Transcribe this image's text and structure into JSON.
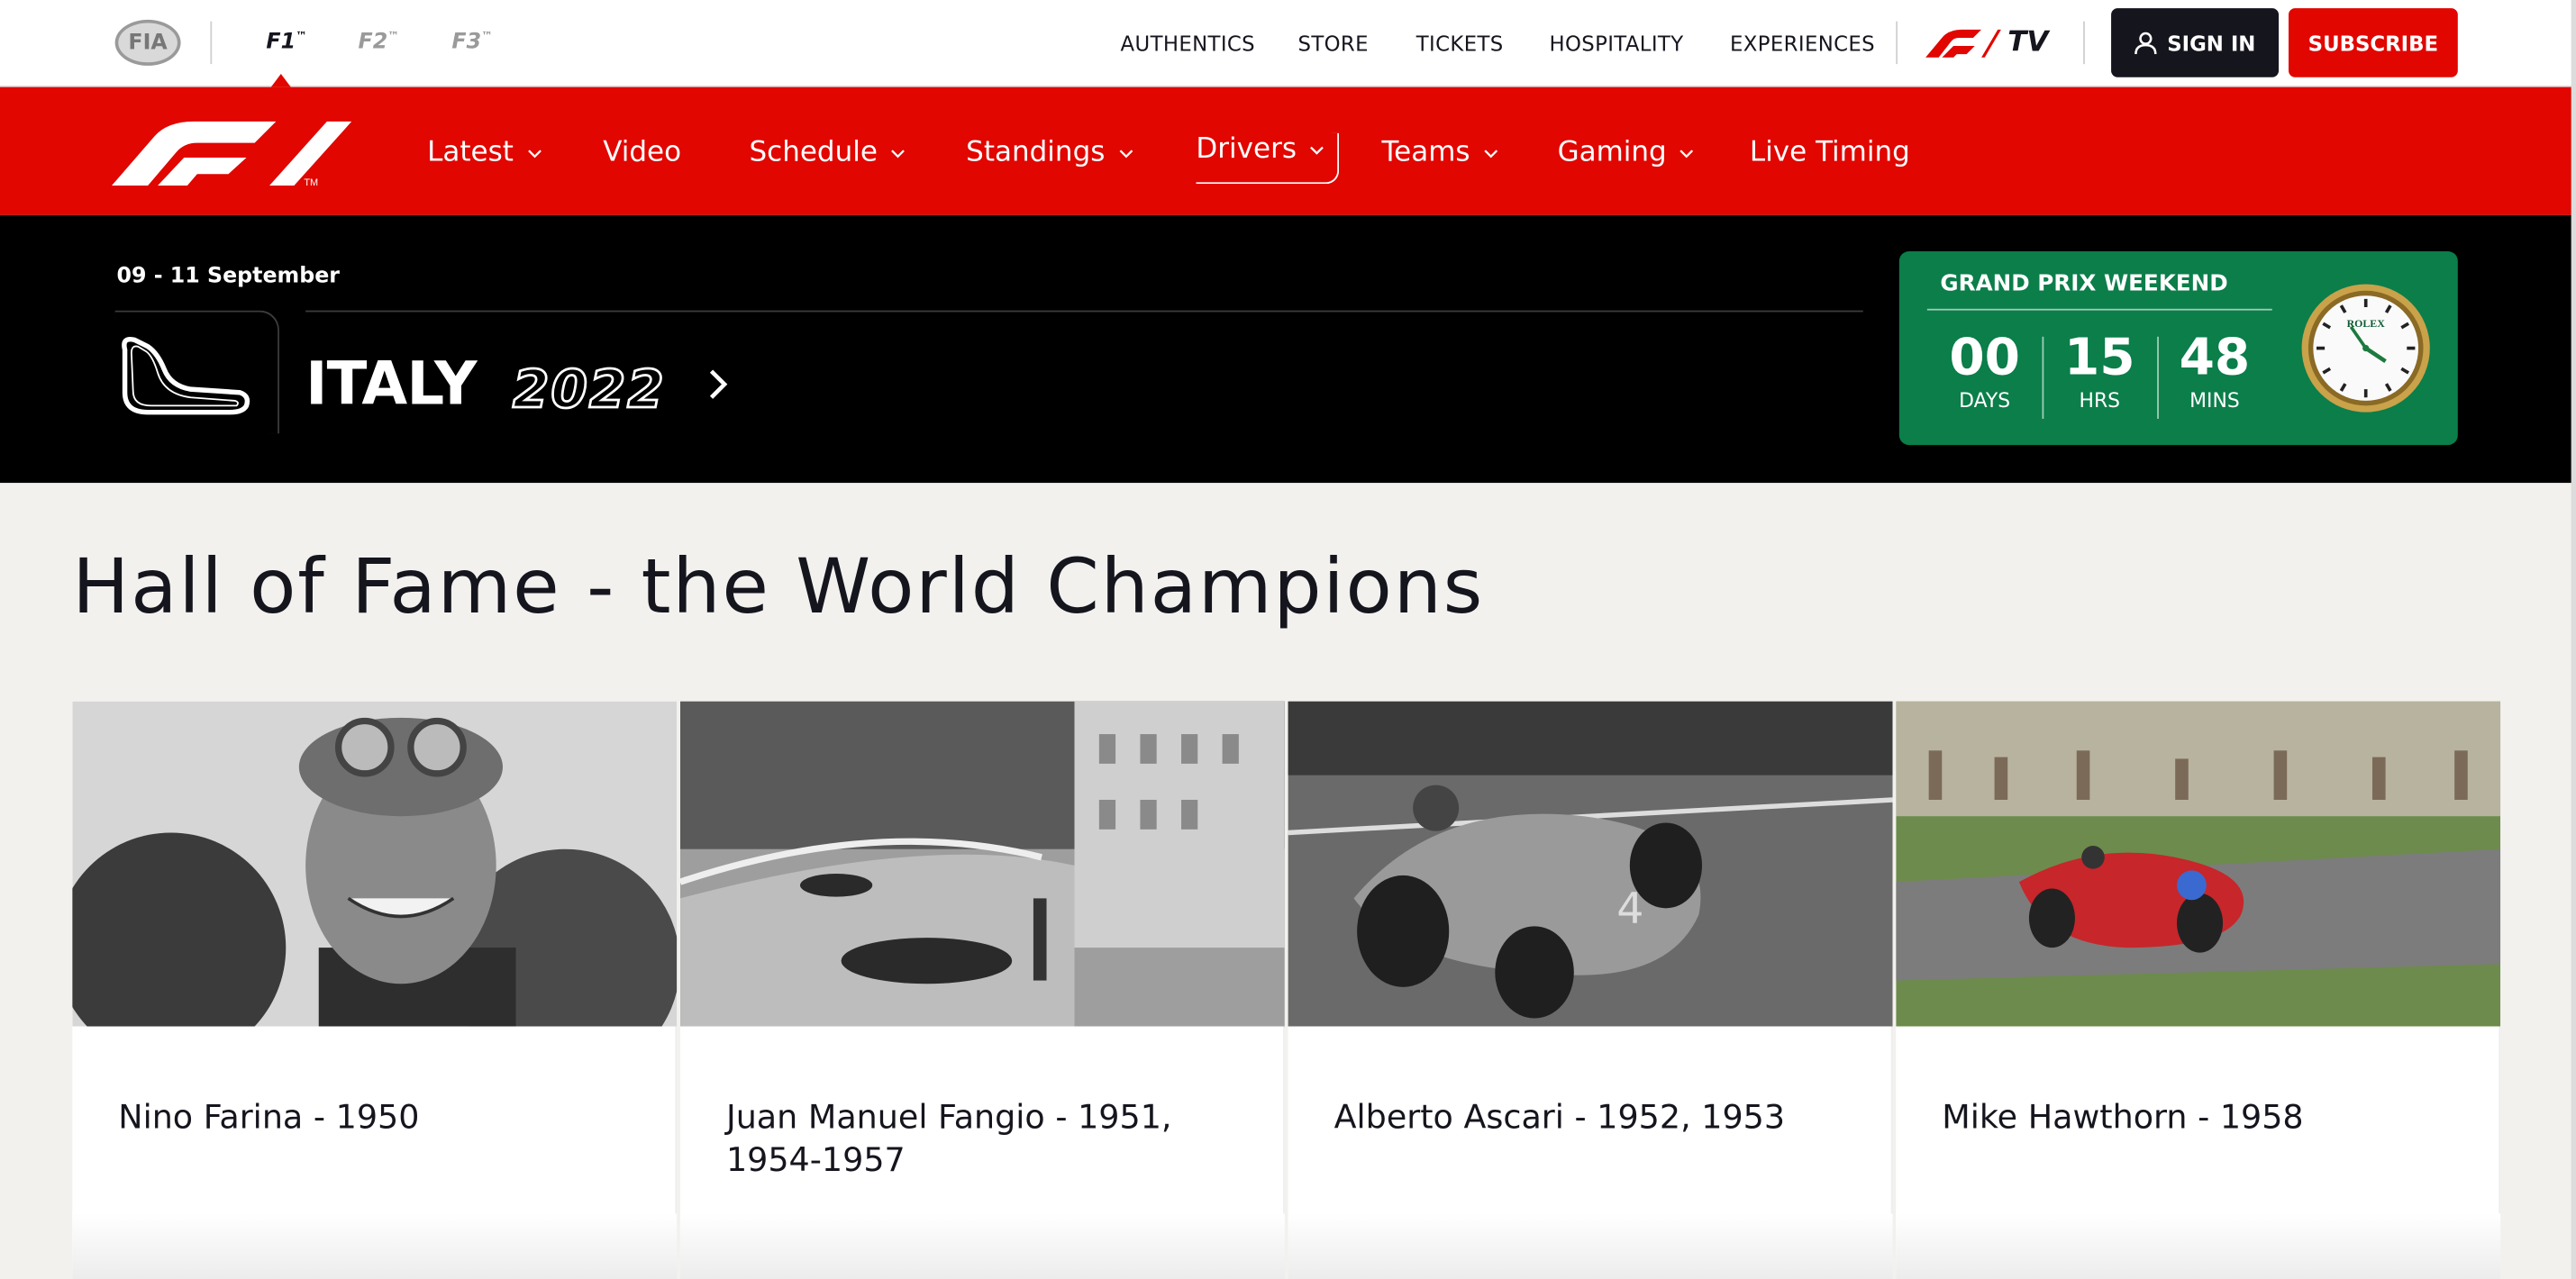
{
  "topbar": {
    "fia_label": "FIA",
    "series": [
      {
        "label": "F1",
        "tm": "™"
      },
      {
        "label": "F2",
        "tm": "™"
      },
      {
        "label": "F3",
        "tm": "™"
      }
    ],
    "links": [
      "AUTHENTICS",
      "STORE",
      "TICKETS",
      "HOSPITALITY",
      "EXPERIENCES"
    ],
    "f1tv_label": "TV",
    "signin_label": "SIGN IN",
    "subscribe_label": "SUBSCRIBE"
  },
  "nav": {
    "items": [
      {
        "label": "Latest",
        "dropdown": true
      },
      {
        "label": "Video",
        "dropdown": false
      },
      {
        "label": "Schedule",
        "dropdown": true
      },
      {
        "label": "Standings",
        "dropdown": true
      },
      {
        "label": "Drivers",
        "dropdown": true,
        "active": true
      },
      {
        "label": "Teams",
        "dropdown": true
      },
      {
        "label": "Gaming",
        "dropdown": true
      },
      {
        "label": "Live Timing",
        "dropdown": false
      }
    ]
  },
  "race": {
    "dates": "09 - 11 September",
    "country": "ITALY",
    "year": "2022",
    "gpw_title": "GRAND PRIX WEEKEND",
    "countdown": [
      {
        "value": "00",
        "unit": "DAYS"
      },
      {
        "value": "15",
        "unit": "HRS"
      },
      {
        "value": "48",
        "unit": "MINS"
      }
    ],
    "clock_brand": "ROLEX",
    "accent_color": "#0b7e4a"
  },
  "page": {
    "title": "Hall of Fame - the World Champions"
  },
  "champions": [
    {
      "name": "Nino Farina - 1950",
      "photo": "bw-portrait"
    },
    {
      "name": "Juan Manuel Fangio - 1951, 1954-1957",
      "photo": "bw-street-circuit"
    },
    {
      "name": "Alberto Ascari - 1952, 1953",
      "photo": "bw-race-car"
    },
    {
      "name": "Mike Hawthorn - 1958",
      "photo": "color-race-car"
    }
  ],
  "colors": {
    "brand_red": "#e10600",
    "dark": "#15151e",
    "banner": "#000000"
  }
}
